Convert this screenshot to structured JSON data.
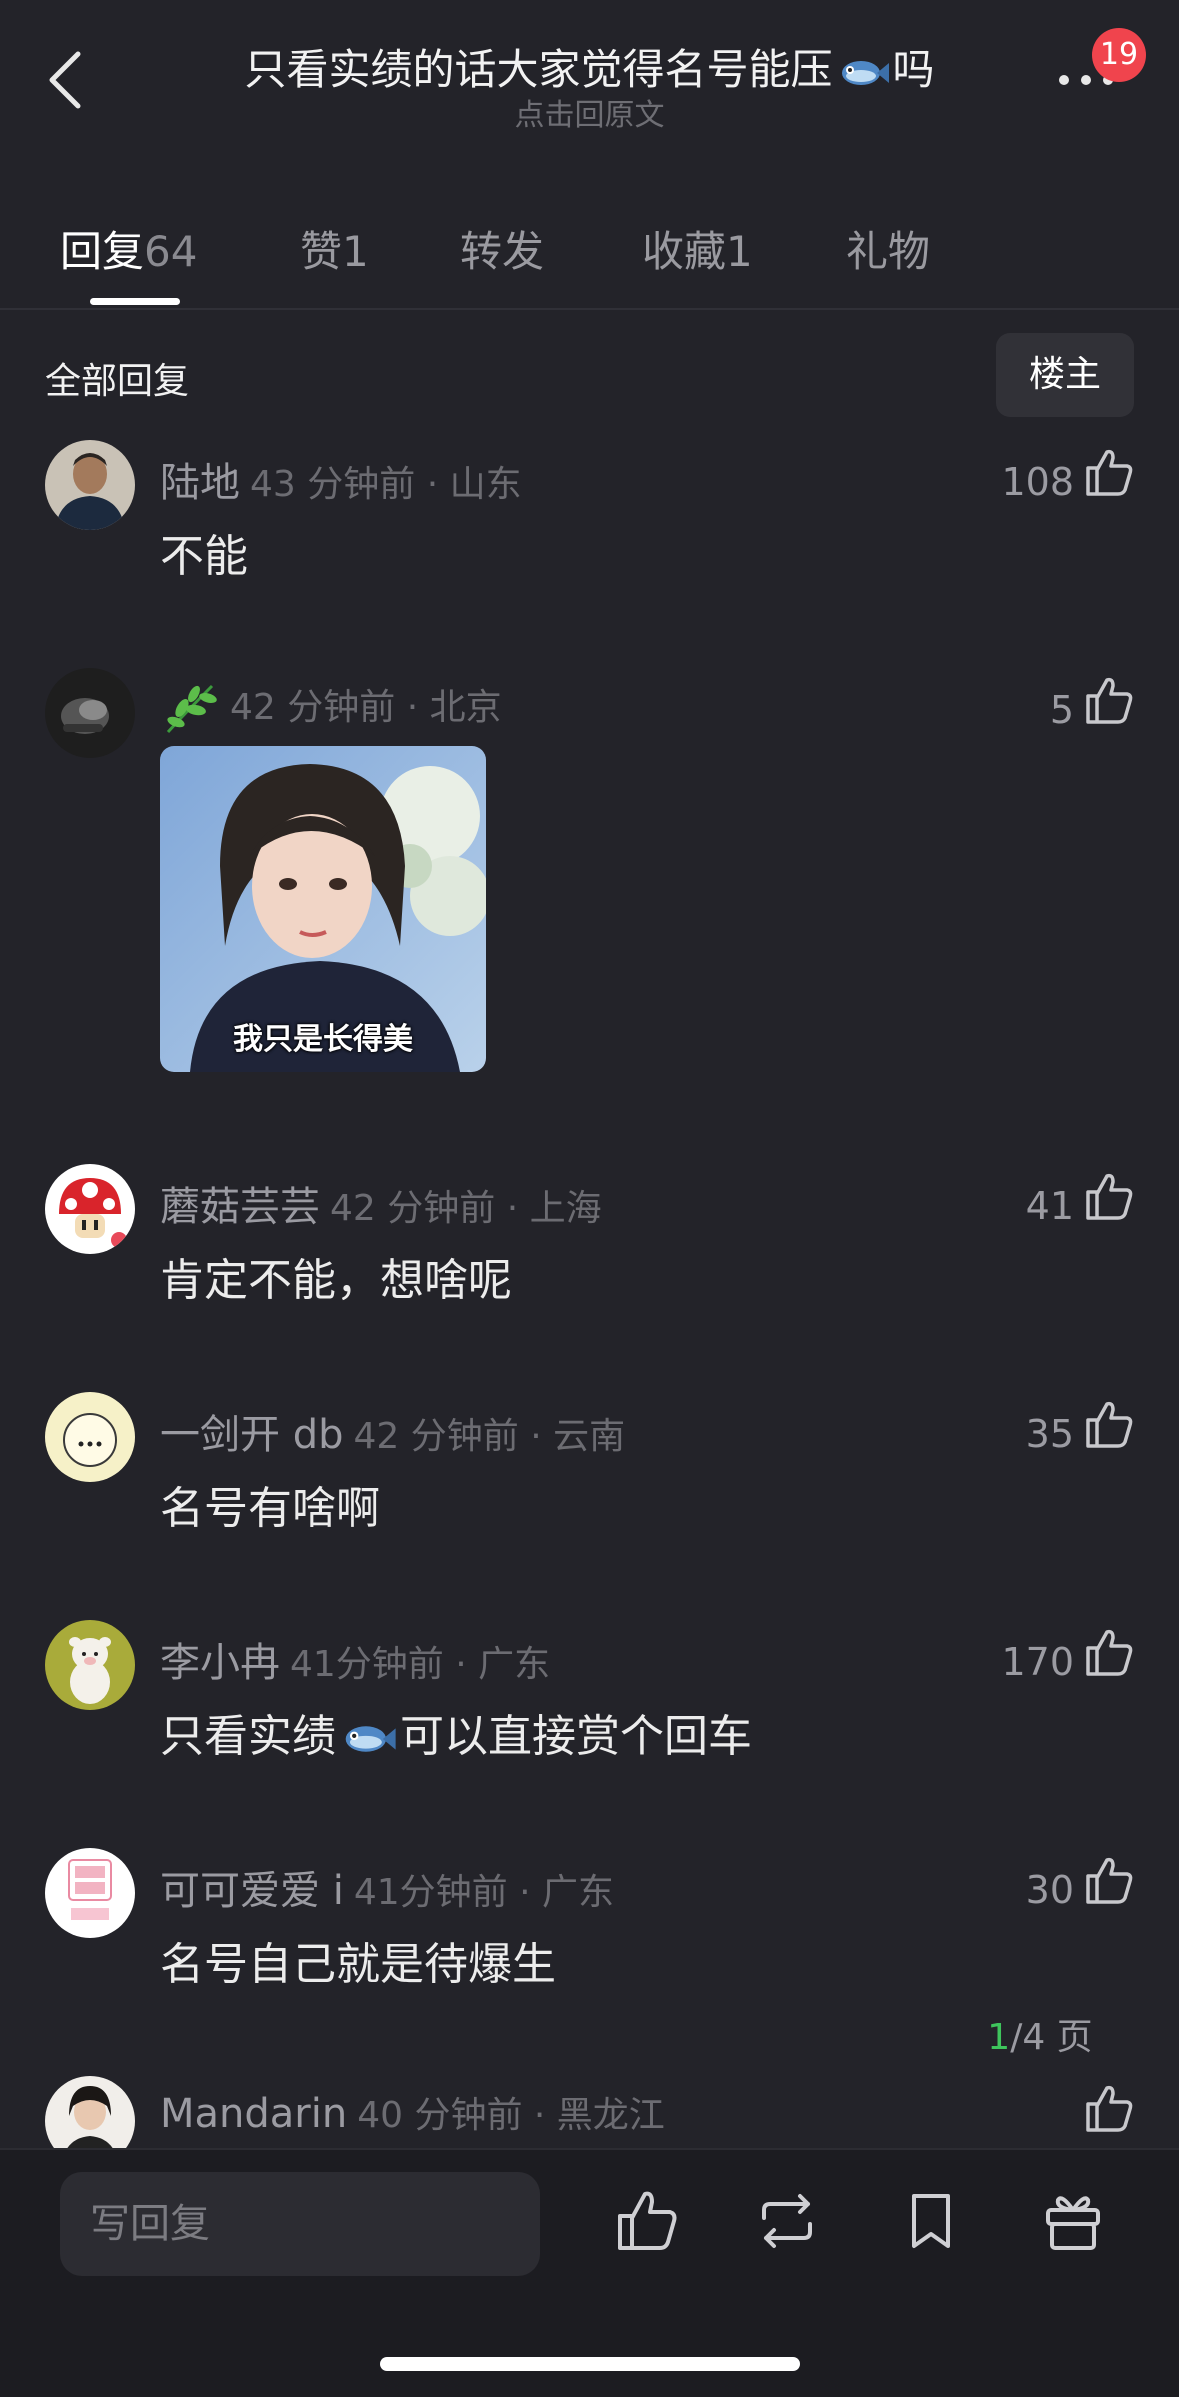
{
  "header": {
    "title": "只看实绩的话大家觉得名号能压",
    "title_suffix": "吗",
    "subtitle": "点击回原文",
    "notification_count": "19"
  },
  "tabs": [
    {
      "label": "回复",
      "count": "64"
    },
    {
      "label": "赞",
      "count": "1"
    },
    {
      "label": "转发",
      "count": ""
    },
    {
      "label": "收藏",
      "count": "1"
    },
    {
      "label": "礼物",
      "count": ""
    }
  ],
  "filter": {
    "all_replies_label": "全部回复",
    "op_only_label": "楼主"
  },
  "comments": [
    {
      "name": "陆地",
      "time": "43 分钟前 · 山东",
      "likes": "108",
      "text": "不能"
    },
    {
      "name": "",
      "time": "42 分钟前 · 北京",
      "likes": "5",
      "image_caption": "我只是长得美"
    },
    {
      "name": "蘑菇芸芸",
      "time": "42 分钟前 · 上海",
      "likes": "41",
      "text": "肯定不能，想啥呢"
    },
    {
      "name": "一剑开 db",
      "time": "42 分钟前 · 云南",
      "likes": "35",
      "text": "名号有啥啊"
    },
    {
      "name": "李小冉",
      "time": "41分钟前 · 广东",
      "likes": "170",
      "text_before": "只看实绩",
      "text_after": "可以直接赏个回车"
    },
    {
      "name": "可可爱爱 i",
      "time": "41分钟前 · 广东",
      "likes": "30",
      "text": "名号自己就是待爆生"
    },
    {
      "name": "Mandarin",
      "time": "40 分钟前 · 黑龙江",
      "likes": ""
    }
  ],
  "pagination": {
    "current": "1",
    "total_label": "/4 页"
  },
  "bottom_bar": {
    "reply_placeholder": "写回复"
  },
  "colors": {
    "background": "#232329",
    "accent_green": "#3ec45c",
    "badge_red": "#f0444d"
  }
}
